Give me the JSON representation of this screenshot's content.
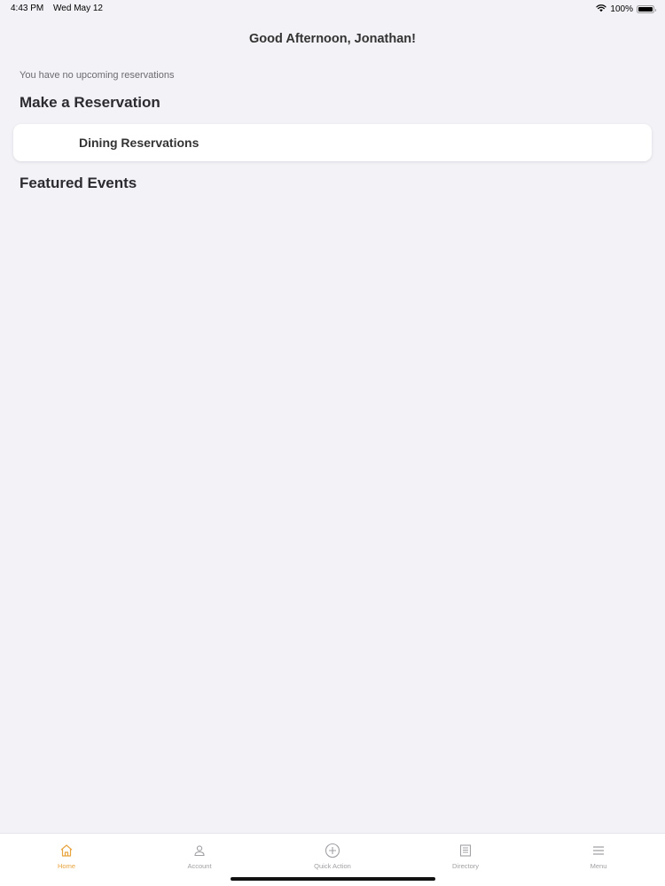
{
  "status_bar": {
    "time": "4:43 PM",
    "date": "Wed May 12",
    "battery": "100%",
    "battery_level": 1.0,
    "icons": [
      "wifi-icon",
      "battery-icon"
    ]
  },
  "greeting": "Good Afternoon, Jonathan!",
  "reservations": {
    "empty_message": "You have no upcoming reservations"
  },
  "make_reservation": {
    "title": "Make a Reservation",
    "options": [
      {
        "label": "Dining Reservations"
      }
    ]
  },
  "featured_events": {
    "title": "Featured Events"
  },
  "tab_bar": {
    "active_color": "#e8a33c",
    "inactive_color": "#a0a0a5",
    "tabs": [
      {
        "label": "Home",
        "icon": "home-icon",
        "active": true
      },
      {
        "label": "Account",
        "icon": "account-icon",
        "active": false
      },
      {
        "label": "Quick Action",
        "icon": "plus-circle-icon",
        "active": false
      },
      {
        "label": "Directory",
        "icon": "directory-icon",
        "active": false
      },
      {
        "label": "Menu",
        "icon": "menu-icon",
        "active": false
      }
    ]
  }
}
